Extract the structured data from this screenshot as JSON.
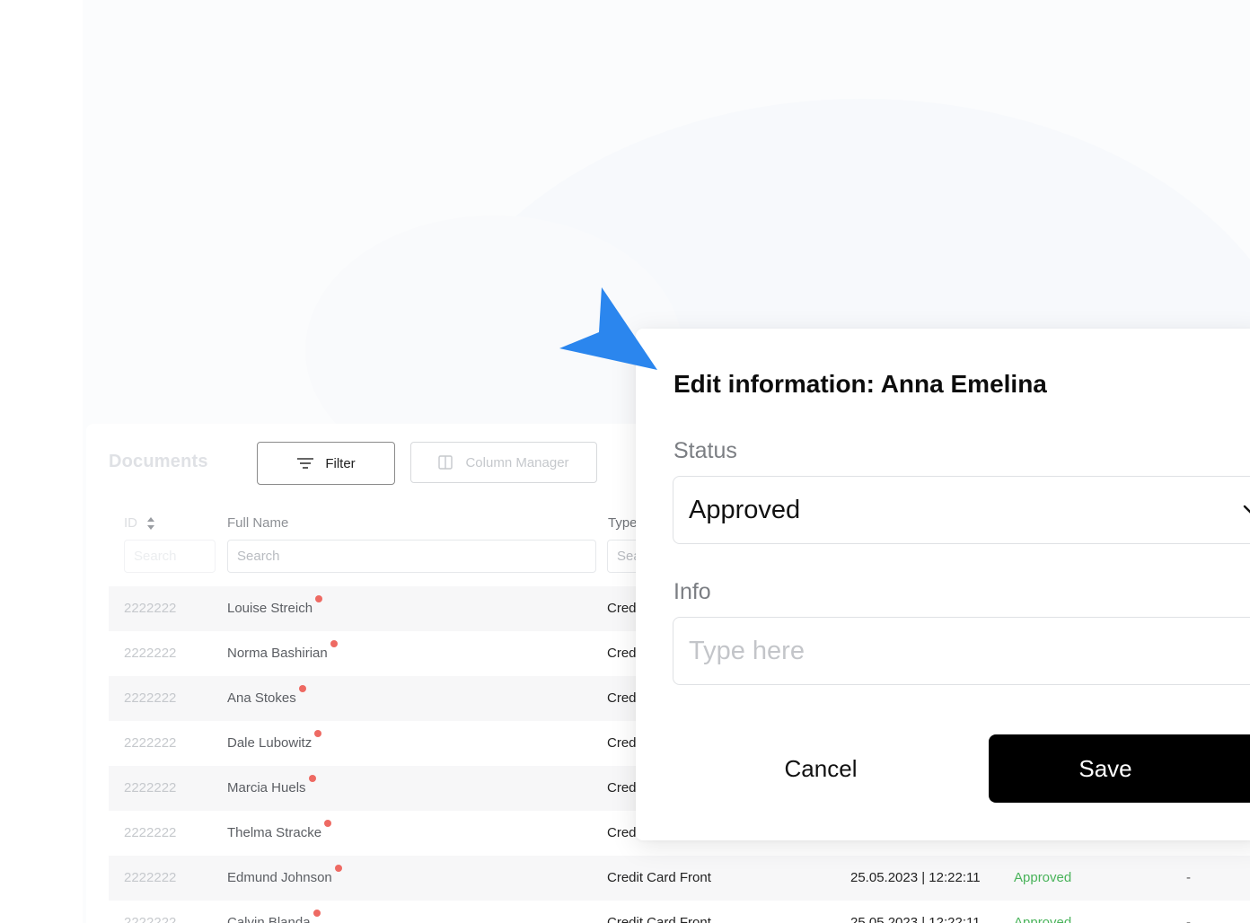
{
  "documents": {
    "title": "Documents",
    "filter_label": "Filter",
    "column_manager_label": "Column Manager",
    "headers": {
      "id": "ID",
      "full_name": "Full Name",
      "type": "Type"
    },
    "search_placeholders": {
      "id": "Search",
      "full_name": "Search",
      "type": "Search"
    },
    "rows": [
      {
        "id": "2222222",
        "name": "Louise Streich",
        "type": "Cred",
        "date": "",
        "status": "",
        "dash": ""
      },
      {
        "id": "2222222",
        "name": "Norma Bashirian",
        "type": "Cred",
        "date": "",
        "status": "",
        "dash": ""
      },
      {
        "id": "2222222",
        "name": "Ana Stokes",
        "type": "Cred",
        "date": "",
        "status": "",
        "dash": ""
      },
      {
        "id": "2222222",
        "name": "Dale Lubowitz",
        "type": "Cred",
        "date": "",
        "status": "",
        "dash": ""
      },
      {
        "id": "2222222",
        "name": "Marcia Huels",
        "type": "Cred",
        "date": "",
        "status": "",
        "dash": ""
      },
      {
        "id": "2222222",
        "name": "Thelma Stracke",
        "type": "Credi",
        "date": "",
        "status": "",
        "dash": ""
      },
      {
        "id": "2222222",
        "name": "Edmund Johnson",
        "type": "Credit Card Front",
        "date": "25.05.2023 | 12:22:11",
        "status": "Approved",
        "dash": "-"
      },
      {
        "id": "2222222",
        "name": "Calvin Blanda",
        "type": "Credit Card Front",
        "date": "25.05.2023 | 12:22:11",
        "status": "Approved",
        "dash": "-"
      }
    ]
  },
  "modal": {
    "title": "Edit information: Anna Emelina",
    "status_label": "Status",
    "status_value": "Approved",
    "info_label": "Info",
    "info_placeholder": "Type here",
    "cancel_label": "Cancel",
    "save_label": "Save"
  },
  "colors": {
    "pointer": "#2b86ee",
    "approved": "#49b35a",
    "unread_dot": "#ee6a63",
    "save_bg": "#000000"
  },
  "icons": {
    "filter": "filter-lines-icon",
    "column_manager": "columns-icon",
    "sort": "sort-arrows-icon",
    "select_chevron": "chevron-down-icon",
    "cursor": "pointer-arrow-icon"
  }
}
